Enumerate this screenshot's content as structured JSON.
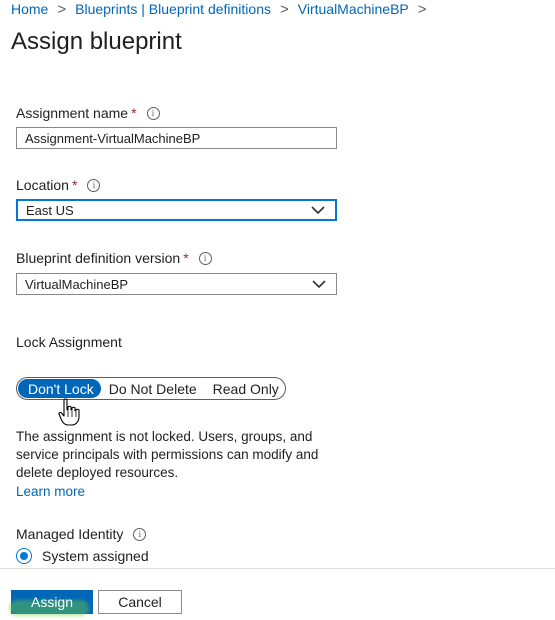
{
  "breadcrumb": {
    "items": [
      "Home",
      "Blueprints | Blueprint definitions",
      "VirtualMachineBP"
    ],
    "separator": ">"
  },
  "page": {
    "title": "Assign blueprint"
  },
  "form": {
    "assignment_name": {
      "label": "Assignment name",
      "required_mark": "*",
      "value": "Assignment-VirtualMachineBP"
    },
    "location": {
      "label": "Location",
      "required_mark": "*",
      "value": "East US"
    },
    "blueprint_version": {
      "label": "Blueprint definition version",
      "required_mark": "*",
      "value": "VirtualMachineBP"
    },
    "lock": {
      "label": "Lock Assignment",
      "options": [
        "Don't Lock",
        "Do Not Delete",
        "Read Only"
      ],
      "selected": "Don't Lock",
      "description": "The assignment is not locked. Users, groups, and service principals with permissions can modify and delete deployed resources.",
      "learn_more": "Learn more"
    },
    "managed_identity": {
      "label": "Managed Identity",
      "option": "System assigned"
    }
  },
  "footer": {
    "assign_label": "Assign",
    "cancel_label": "Cancel"
  },
  "icons": {
    "info": "info-icon",
    "chevron": "chevron-down-icon",
    "cursor": "hand-pointer-icon"
  },
  "colors": {
    "accent": "#0067b8",
    "required": "#a4262c",
    "focus": "#0078d4"
  }
}
